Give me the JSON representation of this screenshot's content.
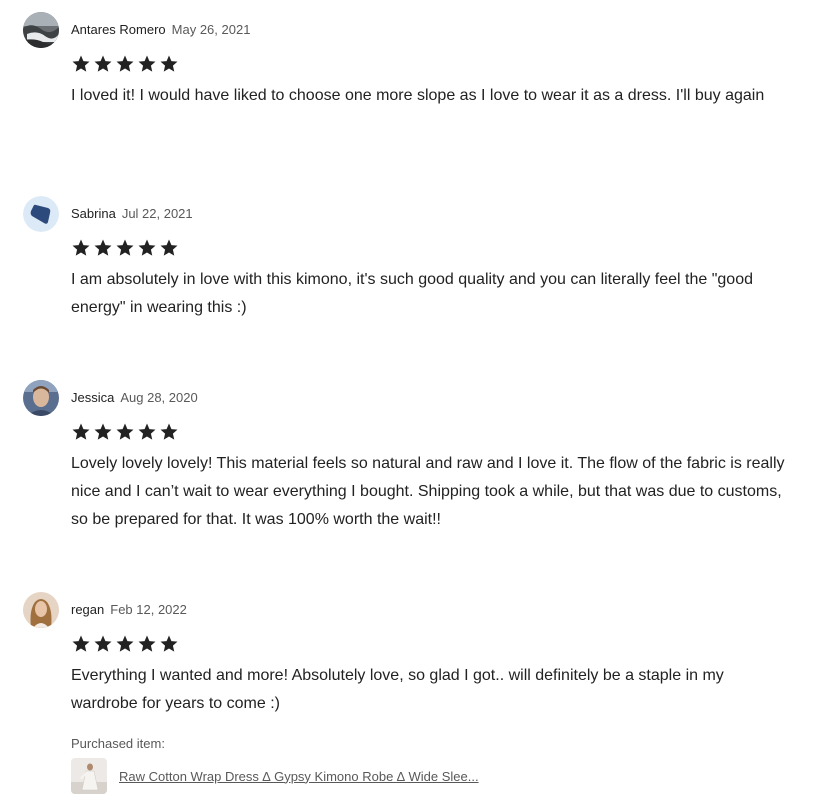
{
  "reviews": [
    {
      "name": "Antares Romero",
      "date": "May 26, 2021",
      "rating": 5,
      "avatar_icon": "photo-avatar-landscape",
      "text": "I loved it! I would have liked to choose one more slope as I love to wear it as a dress. I'll buy again"
    },
    {
      "name": "Sabrina",
      "date": "Jul 22, 2021",
      "rating": 5,
      "avatar_icon": "default-avatar-icon",
      "text": "I am absolutely in love with this kimono, it's such good quality and you can literally feel the \"good energy\" in wearing this :)"
    },
    {
      "name": "Jessica",
      "date": "Aug 28, 2020",
      "rating": 5,
      "avatar_icon": "photo-avatar-portrait",
      "text": "Lovely lovely lovely! This material feels so natural and raw and I love it. The flow of the fabric is really nice and I can’t wait to wear everything I bought. Shipping took a while, but that was due to customs, so be prepared for that. It was 100% worth the wait!!"
    },
    {
      "name": "regan",
      "date": "Feb 12, 2022",
      "rating": 5,
      "avatar_icon": "photo-avatar-portrait",
      "text": "Everything I wanted and more! Absolutely love, so glad I got.. will definitely be a staple in my wardrobe for years to come :)"
    }
  ],
  "purchased": {
    "label": "Purchased item:",
    "item_title": "Raw Cotton Wrap Dress ∆ Gypsy Kimono Robe ∆ Wide Slee..."
  },
  "colors": {
    "text": "#222222",
    "muted": "#595959",
    "star": "#222222",
    "default_avatar_bg": "#dce9f6",
    "default_avatar_fg": "#2c4a7c"
  }
}
